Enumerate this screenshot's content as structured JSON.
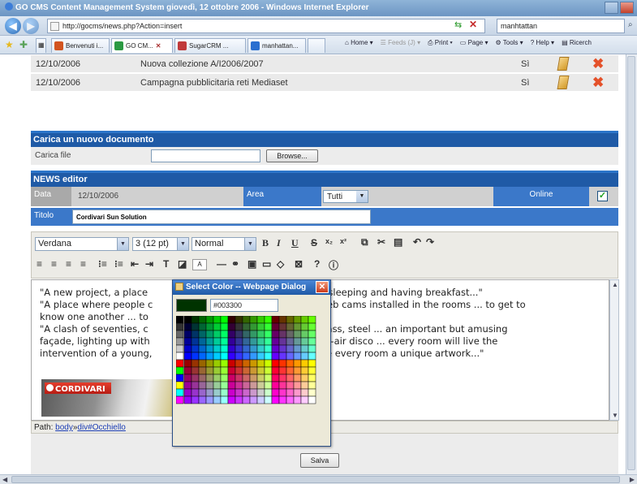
{
  "window": {
    "title": "GO CMS Content Management System giovedì, 12 ottobre 2006 - Windows Internet Explorer"
  },
  "addressbar": {
    "url": "http://gocms/news.php?Action=insert",
    "search_value": "manhtattan"
  },
  "tabs": [
    {
      "label": "Benvenuti i...",
      "color": "#d2541f"
    },
    {
      "label": "GO CM...",
      "color": "#2c9a42"
    },
    {
      "label": "SugarCRM ...",
      "color": "#c03a3a"
    },
    {
      "label": "manhattan...",
      "color": "#2a6fd0"
    }
  ],
  "commandbar": {
    "home": "Home",
    "feeds": "Feeds (J)",
    "print": "Print",
    "page": "Page",
    "tools": "Tools",
    "help": "Help",
    "research": "Ricerch"
  },
  "news_rows": [
    {
      "date": "12/10/2006",
      "title": "Nuova collezione A/I2006/2007",
      "online": "Sì"
    },
    {
      "date": "12/10/2006",
      "title": "Campagna pubblicitaria reti Mediaset",
      "online": "Sì"
    }
  ],
  "upload": {
    "heading": "Carica un nuovo documento",
    "label": "Carica file",
    "browse_label": "Browse..."
  },
  "news_editor": {
    "heading": "NEWS editor",
    "date_label": "Data",
    "date_value": "12/10/2006",
    "area_label": "Area",
    "area_value": "Tutti",
    "online_label": "Online",
    "online_checked": true,
    "title_label": "Titolo",
    "title_value": "Cordivari Sun Solution"
  },
  "toolbar": {
    "font": "Verdana",
    "size": "3 (12 pt)",
    "format": "Normal",
    "letter_sample": "A"
  },
  "editor_text": [
    "\"A new project, a place",
    "t just for sleeping and having breakfast...\"",
    "\"A place where people c",
    "and web cams installed in the rooms ... to get to",
    "know one another ... to",
    "\"A clash of seventies, c",
    "stics, glass, steel ... an important but amusing",
    "façade, lighting up with",
    "open-air disco ... every room will live the",
    "intervention of a young,",
    "make every room a unique artwork...\""
  ],
  "logo_brand": "CORDIVARI",
  "path": {
    "label": "Path:",
    "segments": [
      "body",
      "div#Occhiello"
    ],
    "separator": "»"
  },
  "save_label": "Salva",
  "color_dialog": {
    "title": "Select Color -- Webpage Dialog",
    "hex_value": "#003300",
    "preview_color": "#003300"
  }
}
